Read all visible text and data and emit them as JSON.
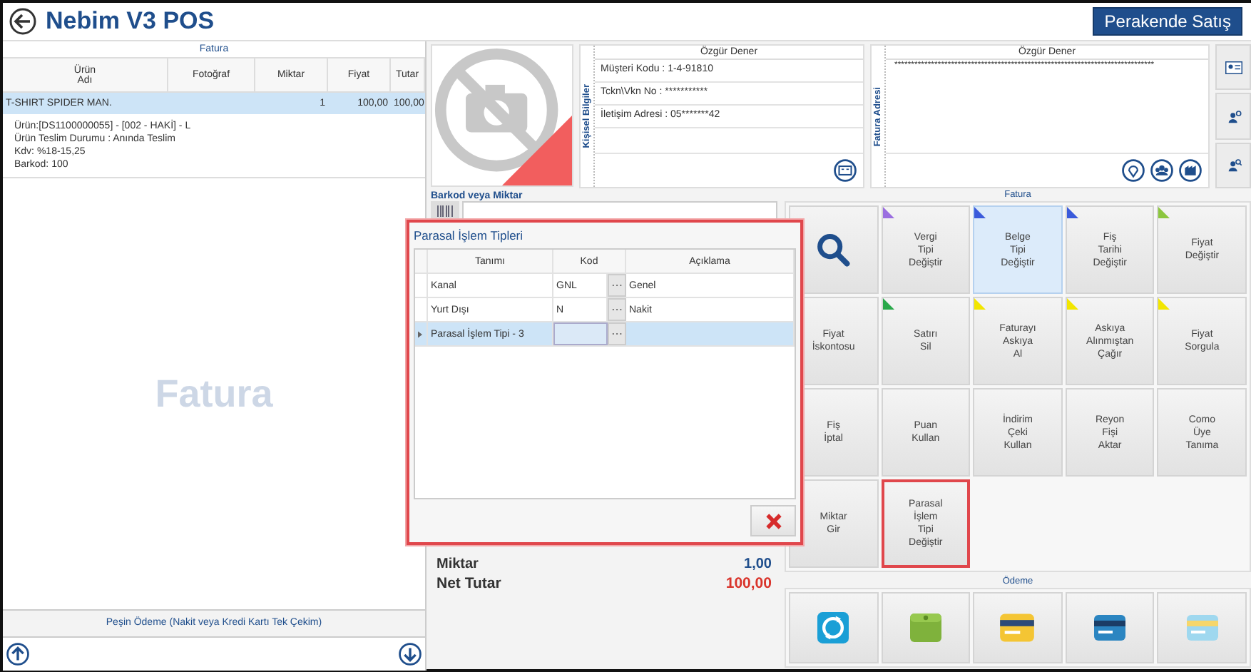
{
  "header": {
    "title": "Nebim V3 POS",
    "mode_button": "Perakende Satış"
  },
  "invoice": {
    "title": "Fatura",
    "columns": [
      "Ürün\nAdı",
      "Fotoğraf",
      "Miktar",
      "Fiyat",
      "Tutar"
    ],
    "rows": [
      {
        "cells": [
          "T-SHIRT SPIDER MAN.",
          "",
          "1",
          "100,00",
          "100,00"
        ],
        "selected": true,
        "details": [
          "Ürün:[DS1100000055] - [002 - HAKİ] - L",
          "Ürün Teslim Durumu : Anında Teslim",
          "Kdv: %18-15,25",
          "Barkod: 100"
        ]
      }
    ],
    "empty_label": "Fatura",
    "payment_type": "Peşin Ödeme (Nakit veya Kredi Kartı Tek Çekim)"
  },
  "customer": {
    "name": "Özgür Dener",
    "section_label": "Kişisel Bilgiler",
    "lines": [
      "Müşteri Kodu  :  1-4-91810",
      "Tckn\\Vkn No  :  ***********",
      "İletişim Adresi : 05*******42"
    ]
  },
  "address": {
    "section_label": "Fatura Adresi",
    "name": "Özgür Dener",
    "text": "******************************************************************************"
  },
  "barcode": {
    "label": "Barkod veya Miktar"
  },
  "totals": [
    {
      "label": "Miktar",
      "value": "1,00",
      "kind": "plain"
    },
    {
      "label": "Net Tutar",
      "value": "100,00",
      "kind": "net"
    }
  ],
  "actions": {
    "title": "Fatura",
    "buttons": [
      {
        "kind": "search",
        "selected": false,
        "highlighted": false
      },
      {
        "kind": "text",
        "label": "Vergi\nTipi\nDeğiştir",
        "color": "#9b6fe0",
        "selected": false,
        "highlighted": false
      },
      {
        "kind": "text",
        "label": "Belge\nTipi\nDeğiştir",
        "color": "#3b5bdb",
        "selected": true,
        "highlighted": false
      },
      {
        "kind": "text",
        "label": "Fiş\nTarihi\nDeğiştir",
        "color": "#3b5bdb",
        "selected": false,
        "highlighted": false
      },
      {
        "kind": "text",
        "label": "Fiyat\nDeğiştir",
        "color": "#8cc63f",
        "selected": false,
        "highlighted": false
      },
      {
        "kind": "text",
        "label": "Fiyat\nİskontosu",
        "selected": false,
        "highlighted": false
      },
      {
        "kind": "text",
        "label": "Satırı\nSil",
        "color": "#2aa84a",
        "selected": false,
        "highlighted": false
      },
      {
        "kind": "text",
        "label": "Faturayı\nAskıya\nAl",
        "color": "#f2e600",
        "selected": false,
        "highlighted": false
      },
      {
        "kind": "text",
        "label": "Askıya\nAlınmıştan\nÇağır",
        "color": "#f2e600",
        "selected": false,
        "highlighted": false
      },
      {
        "kind": "text",
        "label": "Fiyat\nSorgula",
        "color": "#f2e600",
        "selected": false,
        "highlighted": false
      },
      {
        "kind": "text",
        "label": "Fiş\nİptal",
        "selected": false,
        "highlighted": false
      },
      {
        "kind": "text",
        "label": "Puan\nKullan",
        "selected": false,
        "highlighted": false
      },
      {
        "kind": "text",
        "label": "İndirim\nÇeki\nKullan",
        "selected": false,
        "highlighted": false
      },
      {
        "kind": "text",
        "label": "Reyon\nFişi\nAktar",
        "selected": false,
        "highlighted": false
      },
      {
        "kind": "text",
        "label": "Como\nÜye\nTanıma",
        "selected": false,
        "highlighted": false
      },
      {
        "kind": "text",
        "label": "Miktar\nGir",
        "selected": false,
        "highlighted": false
      },
      {
        "kind": "text",
        "label": "Parasal\nİşlem\nTipi\nDeğiştir",
        "selected": false,
        "highlighted": true
      }
    ]
  },
  "payment": {
    "title": "Ödeme"
  },
  "dialog": {
    "title": "Parasal İşlem Tipleri",
    "columns": [
      "Tanımı",
      "Kod",
      "Açıklama"
    ],
    "rows": [
      {
        "name": "Kanal",
        "code": "GNL",
        "description": "Genel",
        "selected": false
      },
      {
        "name": "Yurt Dışı",
        "code": "N",
        "description": "Nakit",
        "selected": false
      },
      {
        "name": "Parasal İşlem Tipi - 3",
        "selected": true
      }
    ]
  }
}
